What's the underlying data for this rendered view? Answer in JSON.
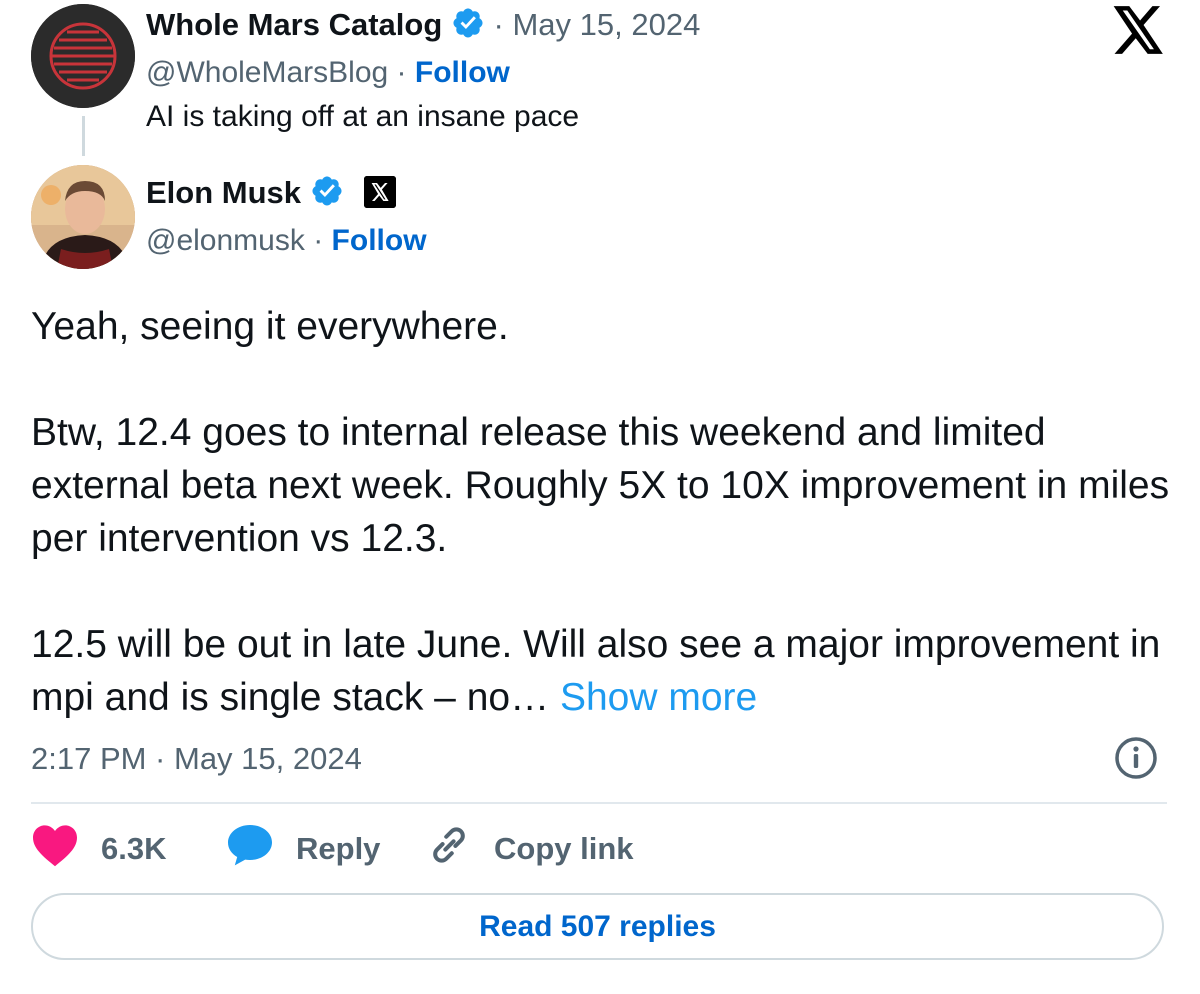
{
  "parent": {
    "name": "Whole Mars Catalog",
    "date": "May 15, 2024",
    "handle": "@WholeMarsBlog",
    "follow_label": "Follow",
    "text": "AI is taking off at an insane pace",
    "separator": "·"
  },
  "main": {
    "name": "Elon Musk",
    "handle": "@elonmusk",
    "follow_label": "Follow",
    "separator": "·",
    "body": {
      "p1": "Yeah, seeing it everywhere.",
      "p2": "Btw, 12.4 goes to internal release this weekend and limited external beta next week. Roughly 5X to 10X improvement in miles per intervention vs 12.3.",
      "p3": "12.5 will be out in late June. Will also see a major improvement in mpi and is single stack – no…",
      "show_more": "Show more"
    },
    "timestamp": "2:17 PM · May 15, 2024"
  },
  "actions": {
    "likes": "6.3K",
    "reply_label": "Reply",
    "copy_label": "Copy link"
  },
  "read_replies_label": "Read 507 replies",
  "icons": {
    "verified": "verified-badge-icon",
    "x_logo": "x-logo-icon",
    "heart": "heart-icon",
    "reply": "speech-bubble-icon",
    "link": "link-icon",
    "info": "info-icon"
  },
  "colors": {
    "follow_blue": "#0066cc",
    "show_more_blue": "#1d9bf0",
    "heart_pink": "#f91880",
    "reply_blue": "#1d9bf0",
    "verified_blue": "#1d9bf0"
  }
}
